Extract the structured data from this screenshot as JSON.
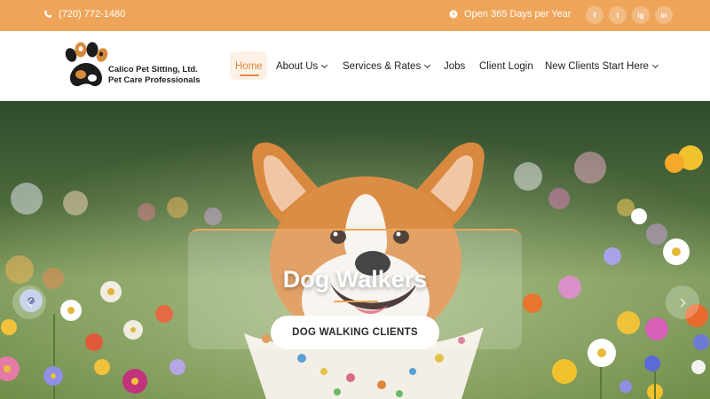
{
  "topbar": {
    "phone": "(720) 772-1480",
    "hours": "Open 365 Days per Year",
    "social": [
      {
        "icon": "facebook-icon",
        "glyph": "f"
      },
      {
        "icon": "twitter-icon",
        "glyph": "t"
      },
      {
        "icon": "instagram-icon",
        "glyph": "ig"
      },
      {
        "icon": "linkedin-icon",
        "glyph": "in"
      }
    ]
  },
  "brand": {
    "line1": "Calico Pet Sitting, Ltd.",
    "line2": "Pet Care Professionals"
  },
  "nav": [
    {
      "label": "Home",
      "active": true,
      "dropdown": false
    },
    {
      "label": "About Us",
      "active": false,
      "dropdown": true
    },
    {
      "label": "Services & Rates",
      "active": false,
      "dropdown": true
    },
    {
      "label": "Jobs",
      "active": false,
      "dropdown": false
    },
    {
      "label": "Client Login",
      "active": false,
      "dropdown": false
    },
    {
      "label": "New Clients Start Here",
      "active": false,
      "dropdown": true
    }
  ],
  "hero": {
    "title": "Dog Walkers",
    "cta": "DOG WALKING CLIENTS"
  },
  "colors": {
    "accent": "#eea55a",
    "active_nav": "#e0883a"
  }
}
